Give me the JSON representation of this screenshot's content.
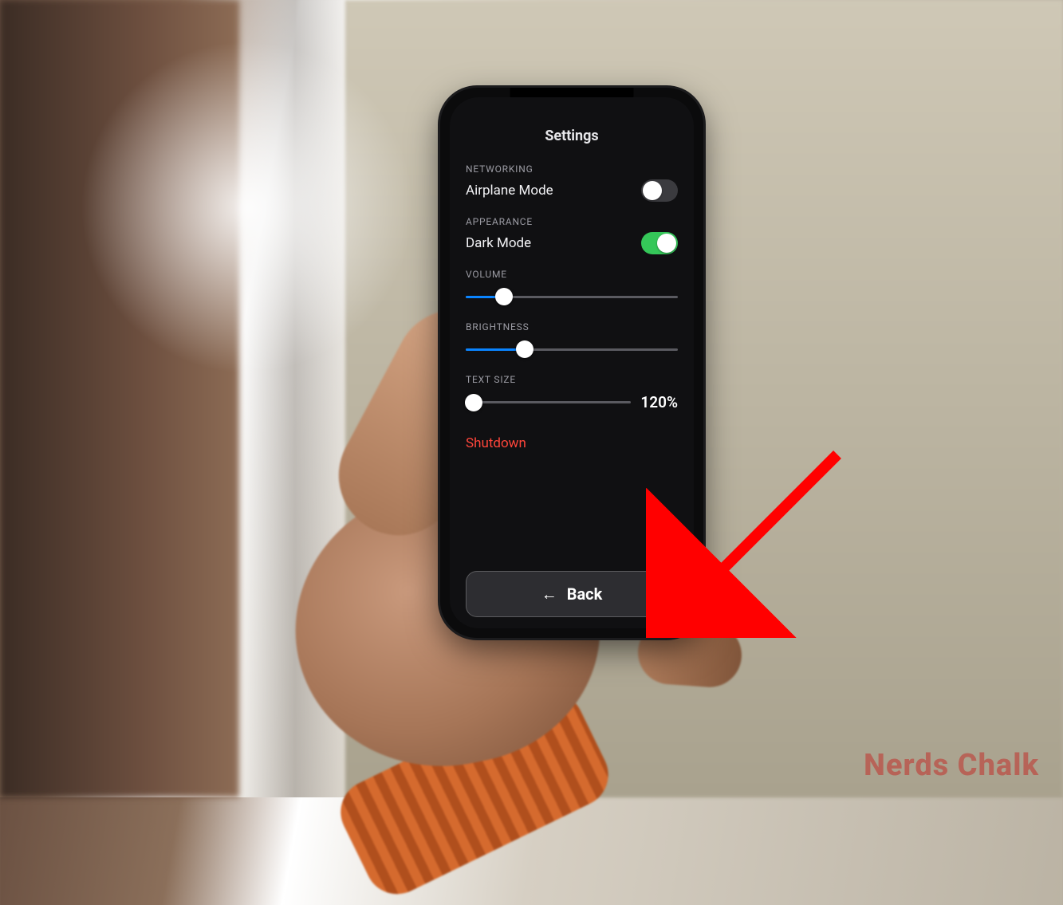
{
  "screen_title": "Settings",
  "sections": {
    "networking": {
      "label": "NETWORKING",
      "airplane": {
        "label": "Airplane Mode",
        "on": false
      }
    },
    "appearance": {
      "label": "APPEARANCE",
      "dark": {
        "label": "Dark Mode",
        "on": true
      }
    },
    "volume": {
      "label": "VOLUME",
      "value_pct": 18
    },
    "brightness": {
      "label": "BRIGHTNESS",
      "value_pct": 28
    },
    "text_size": {
      "label": "TEXT SIZE",
      "value_pct": 5,
      "display": "120%"
    }
  },
  "shutdown_label": "Shutdown",
  "back_label": "Back",
  "watermark": "Nerds Chalk",
  "annotation": {
    "arrow_points_to": "back-button",
    "color": "#ff0000"
  }
}
